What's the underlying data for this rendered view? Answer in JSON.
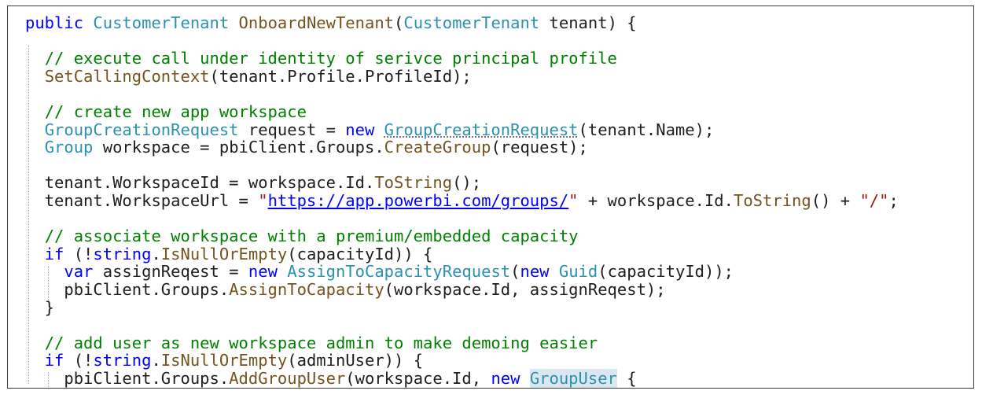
{
  "code_lines": [
    [
      {
        "t": "public",
        "c": "kw"
      },
      {
        "t": " ",
        "c": "plain"
      },
      {
        "t": "CustomerTenant",
        "c": "type"
      },
      {
        "t": " ",
        "c": "plain"
      },
      {
        "t": "OnboardNewTenant",
        "c": "mtd"
      },
      {
        "t": "(",
        "c": "plain"
      },
      {
        "t": "CustomerTenant",
        "c": "type"
      },
      {
        "t": " tenant) {",
        "c": "plain"
      }
    ],
    [],
    [
      {
        "t": "  ",
        "c": "plain"
      },
      {
        "t": "// execute call under identity of serivce principal profile",
        "c": "cm"
      }
    ],
    [
      {
        "t": "  ",
        "c": "plain"
      },
      {
        "t": "SetCallingContext",
        "c": "mtd"
      },
      {
        "t": "(tenant.Profile.ProfileId);",
        "c": "plain"
      }
    ],
    [],
    [
      {
        "t": "  ",
        "c": "plain"
      },
      {
        "t": "// create new app workspace",
        "c": "cm"
      }
    ],
    [
      {
        "t": "  ",
        "c": "plain"
      },
      {
        "t": "GroupCreationRequest",
        "c": "type"
      },
      {
        "t": " request = ",
        "c": "plain"
      },
      {
        "t": "new",
        "c": "kw"
      },
      {
        "t": " ",
        "c": "plain"
      },
      {
        "t": "GroupCreationRequest",
        "c": "type squig"
      },
      {
        "t": "(tenant.Name);",
        "c": "plain"
      }
    ],
    [
      {
        "t": "  ",
        "c": "plain"
      },
      {
        "t": "Group",
        "c": "type"
      },
      {
        "t": " workspace = pbiClient.Groups.",
        "c": "plain"
      },
      {
        "t": "CreateGroup",
        "c": "mtd"
      },
      {
        "t": "(request);",
        "c": "plain"
      }
    ],
    [],
    [
      {
        "t": "  tenant.WorkspaceId = workspace.Id.",
        "c": "plain"
      },
      {
        "t": "ToString",
        "c": "mtd"
      },
      {
        "t": "();",
        "c": "plain"
      }
    ],
    [
      {
        "t": "  tenant.WorkspaceUrl = ",
        "c": "plain"
      },
      {
        "t": "\"",
        "c": "str"
      },
      {
        "t": "https://app.powerbi.com/groups/",
        "c": "url"
      },
      {
        "t": "\"",
        "c": "str"
      },
      {
        "t": " + workspace.Id.",
        "c": "plain"
      },
      {
        "t": "ToString",
        "c": "mtd"
      },
      {
        "t": "() + ",
        "c": "plain"
      },
      {
        "t": "\"/\"",
        "c": "str"
      },
      {
        "t": ";",
        "c": "plain"
      }
    ],
    [],
    [
      {
        "t": "  ",
        "c": "plain"
      },
      {
        "t": "// associate workspace with a premium/embedded capacity",
        "c": "cm"
      }
    ],
    [
      {
        "t": "  ",
        "c": "plain"
      },
      {
        "t": "if",
        "c": "kw"
      },
      {
        "t": " (!",
        "c": "plain"
      },
      {
        "t": "string",
        "c": "kw"
      },
      {
        "t": ".",
        "c": "plain"
      },
      {
        "t": "IsNullOrEmpty",
        "c": "mtd"
      },
      {
        "t": "(capacityId)) {",
        "c": "plain"
      }
    ],
    [
      {
        "t": "    ",
        "c": "plain"
      },
      {
        "t": "var",
        "c": "kw"
      },
      {
        "t": " assignReqest = ",
        "c": "plain"
      },
      {
        "t": "new",
        "c": "kw"
      },
      {
        "t": " ",
        "c": "plain"
      },
      {
        "t": "AssignToCapacityRequest",
        "c": "type"
      },
      {
        "t": "(",
        "c": "plain"
      },
      {
        "t": "new",
        "c": "kw"
      },
      {
        "t": " ",
        "c": "plain"
      },
      {
        "t": "Guid",
        "c": "type"
      },
      {
        "t": "(capacityId));",
        "c": "plain"
      }
    ],
    [
      {
        "t": "    pbiClient.Groups.",
        "c": "plain"
      },
      {
        "t": "AssignToCapacity",
        "c": "mtd"
      },
      {
        "t": "(workspace.Id, assignReqest);",
        "c": "plain"
      }
    ],
    [
      {
        "t": "  }",
        "c": "plain"
      }
    ],
    [],
    [
      {
        "t": "  ",
        "c": "plain"
      },
      {
        "t": "// add user as new workspace admin to make demoing easier",
        "c": "cm"
      }
    ],
    [
      {
        "t": "  ",
        "c": "plain"
      },
      {
        "t": "if",
        "c": "kw"
      },
      {
        "t": " (!",
        "c": "plain"
      },
      {
        "t": "string",
        "c": "kw"
      },
      {
        "t": ".",
        "c": "plain"
      },
      {
        "t": "IsNullOrEmpty",
        "c": "mtd"
      },
      {
        "t": "(adminUser)) {",
        "c": "plain"
      }
    ],
    [
      {
        "t": "    pbiClient.Groups.",
        "c": "plain"
      },
      {
        "t": "AddGroupUser",
        "c": "mtd"
      },
      {
        "t": "(workspace.Id, ",
        "c": "plain"
      },
      {
        "t": "new",
        "c": "kw"
      },
      {
        "t": " ",
        "c": "plain"
      },
      {
        "t": "GroupUser",
        "c": "type hl"
      },
      {
        "t": " {",
        "c": "plain"
      }
    ]
  ],
  "colors": {
    "keyword": "#0000ff",
    "type": "#2b91af",
    "comment": "#008000",
    "string": "#a31515",
    "method": "#74531f",
    "text": "#1e1e1e",
    "highlight": "#dbe7ef"
  }
}
